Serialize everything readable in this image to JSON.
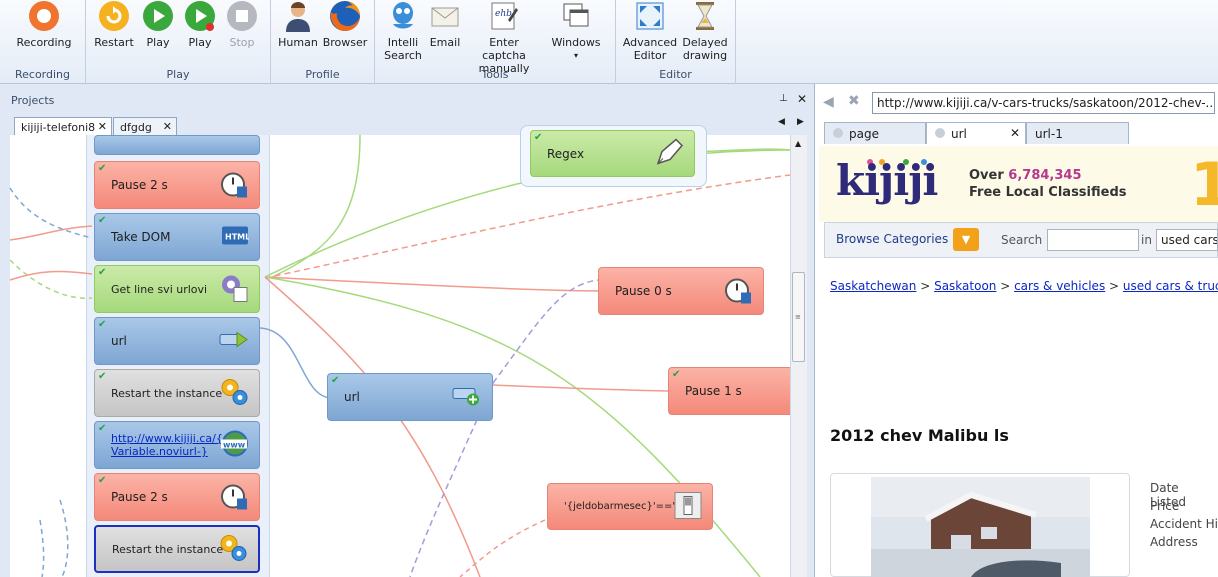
{
  "ribbon": {
    "groups": [
      {
        "title": "Recording",
        "buttons": [
          {
            "label": "Recording",
            "icon": "record-icon"
          }
        ]
      },
      {
        "title": "Play",
        "buttons": [
          {
            "label": "Restart",
            "icon": "restart-icon"
          },
          {
            "label": "Play",
            "icon": "play-icon"
          },
          {
            "label": "Play",
            "icon": "play-stop-icon"
          },
          {
            "label": "Stop",
            "icon": "stop-icon"
          }
        ]
      },
      {
        "title": "Profile",
        "buttons": [
          {
            "label": "Human",
            "icon": "human-icon"
          },
          {
            "label": "Browser",
            "icon": "browser-icon"
          }
        ]
      },
      {
        "title": "Tools",
        "buttons": [
          {
            "label": "Intelli Search",
            "icon": "intelli-search-icon"
          },
          {
            "label": "Email",
            "icon": "email-icon"
          },
          {
            "label": "Enter captcha manually",
            "icon": "captcha-icon"
          },
          {
            "label": "Windows",
            "icon": "windows-icon"
          }
        ]
      },
      {
        "title": "Editor",
        "buttons": [
          {
            "label": "Advanced Editor",
            "icon": "advanced-editor-icon"
          },
          {
            "label": "Delayed drawing",
            "icon": "delayed-drawing-icon"
          }
        ]
      }
    ]
  },
  "projects": {
    "title": "Projects",
    "tabs": [
      "kijiji-telefoni8",
      "dfgdg"
    ],
    "nodes": [
      {
        "label": "Pause 2 s",
        "type": "red"
      },
      {
        "label": "Take DOM",
        "type": "blue"
      },
      {
        "label": "Get line svi urlovi",
        "type": "green"
      },
      {
        "label": "url",
        "type": "blue"
      },
      {
        "label": "Restart the instance",
        "type": "gray"
      },
      {
        "label": "http://www.kijiji.ca/{-Variable.noviurl-}",
        "type": "blue"
      },
      {
        "label": "Pause 2 s",
        "type": "red"
      },
      {
        "label": "Restart the instance",
        "type": "gray"
      }
    ],
    "floating": {
      "regex": "Regex",
      "pause0": "Pause 0 s",
      "url2": "url",
      "pause1": "Pause 1 s",
      "condition": "'{jeldobarmesec}'==\""
    }
  },
  "browser": {
    "url": "http://www.kijiji.ca/v-cars-trucks/saskatoon/2012-chev-...",
    "tabs": [
      "page",
      "url",
      "url-1"
    ],
    "logo": "kijiji",
    "tagline_prefix": "Over",
    "tagline_count": "6,784,345",
    "tagline2": "Free Local Classifieds",
    "browse_categories": "Browse Categories",
    "search_label": "Search",
    "search_in_value": "used cars",
    "in_label": "in",
    "breadcrumbs": [
      "Saskatchewan",
      "Saskatoon",
      "cars & vehicles",
      "used cars & trucks in S"
    ],
    "listing_title": "2012 chev Malibu ls",
    "details": [
      "Date Listed",
      "Price",
      "Accident Hi",
      "Address"
    ]
  }
}
